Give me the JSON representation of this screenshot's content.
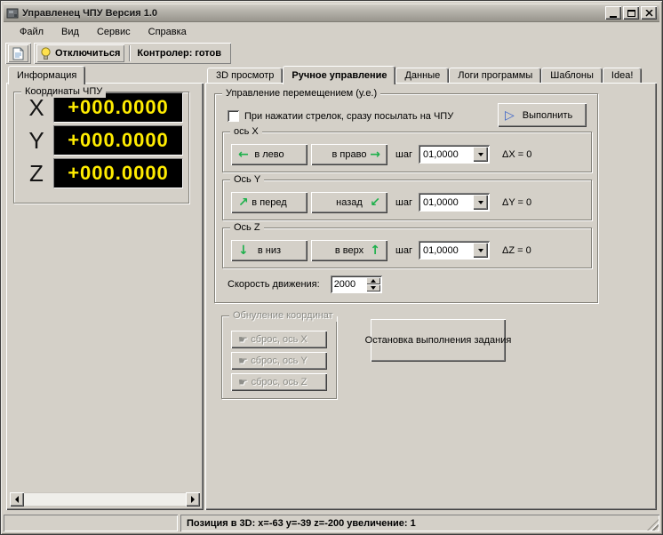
{
  "window": {
    "title": "Управленец ЧПУ Версия 1.0"
  },
  "menu": {
    "items": [
      {
        "label": "Файл"
      },
      {
        "label": "Вид"
      },
      {
        "label": "Сервис"
      },
      {
        "label": "Справка"
      }
    ]
  },
  "toolbar": {
    "disconnect_label": "Отключиться",
    "controller_status": "Контролер: готов"
  },
  "left_panel": {
    "tab_label": "Информация",
    "group_title": "Координаты ЧПУ",
    "coordinates": [
      {
        "axis": "X",
        "value": "+000.0000"
      },
      {
        "axis": "Y",
        "value": "+000.0000"
      },
      {
        "axis": "Z",
        "value": "+000.0000"
      }
    ]
  },
  "right_tabs": [
    {
      "label": "3D просмотр"
    },
    {
      "label": "Ручное управление"
    },
    {
      "label": "Данные"
    },
    {
      "label": "Логи программы"
    },
    {
      "label": "Шаблоны"
    },
    {
      "label": "Idea!"
    }
  ],
  "manual_control": {
    "group_title": "Управление перемещением (у.е.)",
    "checkbox_label": "При нажатии стрелок, сразу посылать на ЧПУ",
    "checkbox_checked": false,
    "execute_label": "Выполнить",
    "axes": [
      {
        "title": "ось X",
        "button_a": "в лево",
        "icon_a": "←",
        "button_b": "в право",
        "icon_b": "→",
        "step_label": "шаг",
        "step_value": "01,0000",
        "delta": "ΔX = 0"
      },
      {
        "title": "Ось Y",
        "button_a": "в перед",
        "icon_a": "↗",
        "button_b": "назад",
        "icon_b": "↙",
        "step_label": "шаг",
        "step_value": "01,0000",
        "delta": "ΔY = 0"
      },
      {
        "title": "Ось Z",
        "button_a": "в низ",
        "icon_a": "↓",
        "button_b": "в верх",
        "icon_b": "↑",
        "step_label": "шаг",
        "step_value": "01,0000",
        "delta": "ΔZ = 0"
      }
    ],
    "speed_label": "Скорость движения:",
    "speed_value": "2000",
    "zero_group_title": "Обнуление координат",
    "zero_buttons": [
      {
        "label": "сброс, ось X"
      },
      {
        "label": "сброс, ось Y"
      },
      {
        "label": "сброс, ось Z"
      }
    ],
    "stop_label": "Остановка выполнения задания"
  },
  "status_bar": {
    "text": "Позиция в 3D: x=-63 y=-39 z=-200 увеличение: 1"
  },
  "icons": {
    "play": "▷",
    "reset_hand": "☛"
  },
  "colors": {
    "lcd_bg": "#000000",
    "lcd_text": "#ffec00",
    "arrow_green": "#1db04b",
    "play_blue": "#3a62c8"
  }
}
